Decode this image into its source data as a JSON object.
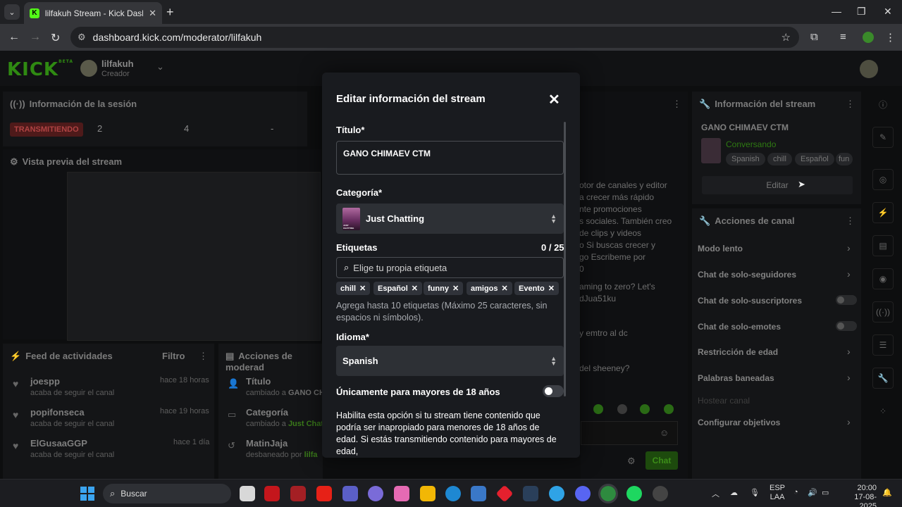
{
  "browser": {
    "tab_title": "lilfakuh Stream - Kick Dashboar",
    "tab_favicon": "K",
    "url": "dashboard.kick.com/moderator/lilfakuh"
  },
  "topnav": {
    "logo": "KICK",
    "logo_badge": "BETA",
    "channel_name": "lilfakuh",
    "channel_role": "Creador"
  },
  "session": {
    "title": "Información de la sesión",
    "live_badge": "TRANSMITIENDO",
    "stats": [
      "2",
      "4",
      "-"
    ]
  },
  "preview": {
    "title": "Vista previa del stream"
  },
  "feed": {
    "title": "Feed de actividades",
    "filter": "Filtro",
    "items": [
      {
        "name": "joespp",
        "sub": "acaba de seguir el canal",
        "time": "hace 18 horas"
      },
      {
        "name": "popifonseca",
        "sub": "acaba de seguir el canal",
        "time": "hace 19 horas"
      },
      {
        "name": "ElGusaaGGP",
        "sub": "acaba de seguir el canal",
        "time": "hace 1 día"
      }
    ]
  },
  "mod_actions": {
    "title": "Acciones de moderad",
    "items": [
      {
        "title": "Título",
        "sub": "cambiado a ",
        "highlight": "GANO CHI"
      },
      {
        "title": "Categoría",
        "sub": "cambiado a ",
        "highlight": "Just Chatti"
      },
      {
        "title": "MatinJaja",
        "sub": "desbaneado por ",
        "highlight": "lilfa"
      }
    ]
  },
  "chat": {
    "lines": [
      "otor de canales y editor",
      "a crecer más rápido",
      "nte promociones",
      "s sociales. También creo",
      "de clips y videos",
      "o Si buscas crecer y",
      "go Escribeme por",
      "0",
      "aming to zero? Let's",
      "dJua51ku",
      "y emtro al dc",
      "del sheeney?"
    ],
    "send_button": "Chat"
  },
  "stream_info": {
    "title": "Información del stream",
    "stream_title": "GANO CHIMAEV CTM",
    "category": "Conversando",
    "tags": [
      "Spanish",
      "chill",
      "Español",
      "fun"
    ],
    "edit_button": "Editar"
  },
  "channel_actions": {
    "title": "Acciones de canal",
    "options": [
      {
        "label": "Modo lento",
        "control": "arrow"
      },
      {
        "label": "Chat de solo-seguidores",
        "control": "arrow"
      },
      {
        "label": "Chat de solo-suscriptores",
        "control": "toggle"
      },
      {
        "label": "Chat de solo-emotes",
        "control": "toggle"
      },
      {
        "label": "Restricción de edad",
        "control": "arrow"
      },
      {
        "label": "Palabras baneadas",
        "control": "arrow"
      },
      {
        "label": "Hostear canal",
        "control": "none"
      },
      {
        "label": "Configurar objetivos",
        "control": "arrow"
      }
    ]
  },
  "modal": {
    "title": "Editar información del stream",
    "title_label": "Título*",
    "title_value": "GANO CHIMAEV CTM",
    "category_label": "Categoría*",
    "category_value": "Just Chatting",
    "tags_label": "Etiquetas",
    "tags_count": "0 / 25",
    "tags_placeholder": "Elige tu propia etiqueta",
    "tags": [
      "chill",
      "Español",
      "funny",
      "amigos",
      "Evento"
    ],
    "tags_help": "Agrega hasta 10 etiquetas (Máximo 25 caracteres, sin espacios ni símbolos).",
    "language_label": "Idioma*",
    "language_value": "Spanish",
    "mature_label": "Únicamente para mayores de 18 años",
    "mature_enabled": false,
    "mature_desc": "Habilita esta opción si tu stream tiene contenido que podría ser inapropiado para menores de 18 años de edad. Si estás transmitiendo contenido para mayores de edad,"
  },
  "taskbar": {
    "search_placeholder": "Buscar",
    "lang_line1": "ESP",
    "lang_line2": "LAA",
    "time": "20:00",
    "date": "17-08-2025"
  },
  "colors": {
    "kick_green": "#53fc18",
    "modal_bg": "#191b1f",
    "chip_bg": "#30333a",
    "live_red": "#b04343"
  }
}
